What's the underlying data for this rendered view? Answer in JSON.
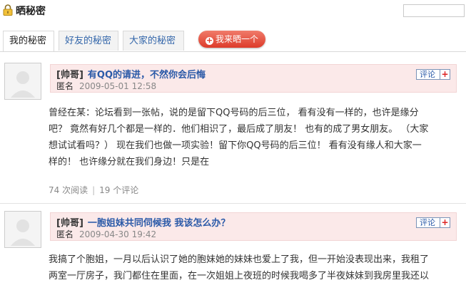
{
  "header": {
    "title": "晒秘密",
    "icon": "lock-icon"
  },
  "tabs": [
    {
      "label": "我的秘密",
      "active": true
    },
    {
      "label": "好友的秘密",
      "active": false
    },
    {
      "label": "大家的秘密",
      "active": false
    }
  ],
  "share_button": {
    "label": "我来晒一个"
  },
  "posts": [
    {
      "author": "[帅哥]",
      "title": "有QQ的请进，不然你会后悔",
      "anon_label": "匿名",
      "date": "2009-05-01 12:58",
      "comment_label": "评论",
      "body_lines": [
        "曾经在某：论坛看到一张帖，说的是留下QQ号码的后三位，  看有没有一样的，也许是缘分",
        "吧？ 竟然有好几个都是一样的．他们相识了，最后成了朋友！ 也有的成了男女朋友。 （大家",
        "想试试看吗？） 现在我们也做一项实验！留下你QQ号码的后三位！ 看有没有缘人和大家一",
        "样的！ 也许缘分就在我们身边！只是在"
      ],
      "views": "74 次阅读",
      "comments": "19 个评论"
    },
    {
      "author": "[帅哥]",
      "title": "一胞姐妹共同伺候我 我该怎么办？",
      "anon_label": "匿名",
      "date": "2009-04-30 19:42",
      "comment_label": "评论",
      "body_lines": [
        "我搞了个胞姐，一月以后认识了她的胞妹她的妹妹也爱上了我，但一开始没表现出来，我租了",
        "两室一厅房子，我门都住在里面，在一次姐姐上夜班的时候我喝多了半夜妹妹到我房里我还以"
      ]
    }
  ],
  "colors": {
    "link": "#2b5aa8",
    "post_header_bg": "#fbe9e9",
    "share_button": "#dd3b2a"
  }
}
